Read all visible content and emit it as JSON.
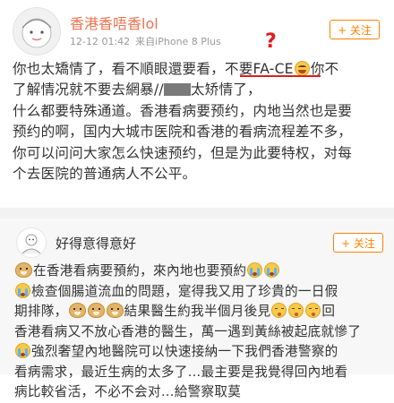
{
  "post": {
    "username": "香港香唔香lol",
    "time": "12-12 01:42",
    "source": "来自iPhone 8 Plus",
    "follow": "+ 关注",
    "annotation": "?",
    "lines": [
      [
        "你也太矯情了，看不順眼還要看，不要FA-CE",
        "你不"
      ],
      [
        "了解情况就不要去網暴//",
        "太矫情了，"
      ],
      [
        "什么都要特殊通道。香港看病要预约，内地当然也是要"
      ],
      [
        "预约的啊，国内大城市医院和香港的看病流程差不多，"
      ],
      [
        "你可以问问大家怎么快速预约，但是为此要特权，对每"
      ],
      [
        "个去医院的普通病人不公平。"
      ]
    ]
  },
  "repost": {
    "username": "好得意得意好",
    "follow": "+ 关注",
    "lines": {
      "l1a": "在香港看病要預約，來內地也要預約",
      "l2": "檢查個腸道流血的問題，寔得我又用了珍貴的一日假",
      "l3a": "期排隊，",
      "l3b": "結果醫生約我半個月後見",
      "l3c": "回",
      "l4": "香港看病又不放心香港的醫生，萬一遇到黃絲被起底就慘了",
      "l5": "強烈奢望內地醫院可以快速接納一下我們香港警察的",
      "l6": "看病需求，最近生病的太多了…最主要是我覺得回內地看",
      "l7": "病比較省活，不必不会对…給警察取莫"
    }
  }
}
